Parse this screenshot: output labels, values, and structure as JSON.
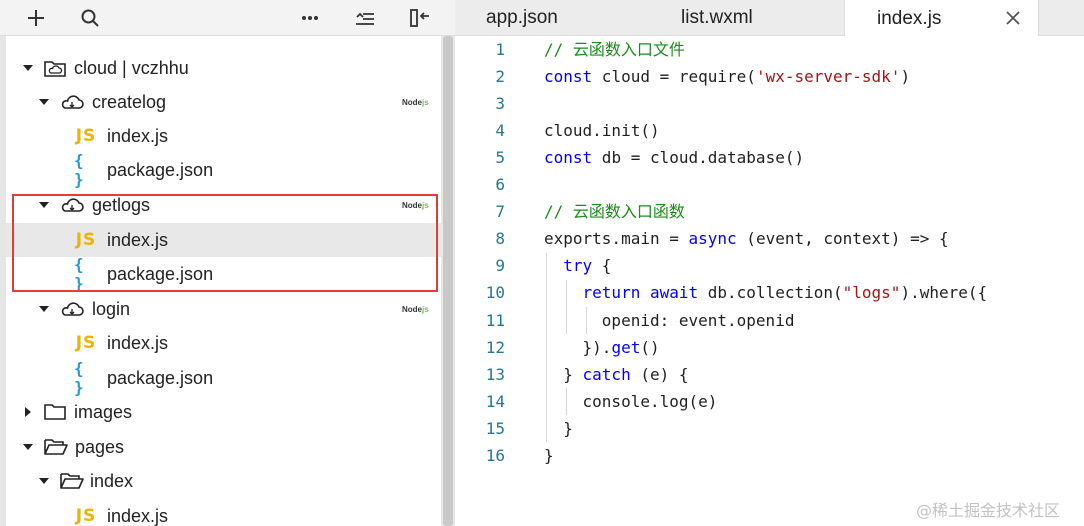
{
  "toolbar": {
    "buttons": [
      "add-icon",
      "search-icon",
      "more-icon",
      "collapse-icon",
      "split-view-icon"
    ]
  },
  "tree": {
    "rows": [
      {
        "label": "cloud | vczhhu",
        "type": "folder-cloud-root",
        "expanded": true
      },
      {
        "label": "createlog",
        "type": "cloud-function",
        "expanded": true,
        "badge": "Node"
      },
      {
        "label": "index.js",
        "type": "js"
      },
      {
        "label": "package.json",
        "type": "json"
      },
      {
        "label": "getlogs",
        "type": "cloud-function",
        "expanded": true,
        "badge": "Node"
      },
      {
        "label": "index.js",
        "type": "js",
        "selected": true
      },
      {
        "label": "package.json",
        "type": "json"
      },
      {
        "label": "login",
        "type": "cloud-function",
        "expanded": true,
        "badge": "Node"
      },
      {
        "label": "index.js",
        "type": "js"
      },
      {
        "label": "package.json",
        "type": "json"
      },
      {
        "label": "images",
        "type": "folder",
        "expanded": false
      },
      {
        "label": "pages",
        "type": "folder",
        "expanded": true
      },
      {
        "label": "index",
        "type": "folder",
        "expanded": true
      },
      {
        "label": "index.js",
        "type": "js"
      }
    ],
    "badge_text": "Node",
    "badge_suffix": "js",
    "js_icon_text": "JS",
    "json_icon_text": "{ }"
  },
  "tabs": [
    {
      "label": "app.json",
      "active": false
    },
    {
      "label": "list.wxml",
      "active": false
    },
    {
      "label": "index.js",
      "active": true
    }
  ],
  "editor": {
    "lines": [
      {
        "n": "1",
        "tokens": [
          [
            "c-comment",
            "// 云函数入口文件"
          ]
        ]
      },
      {
        "n": "2",
        "tokens": [
          [
            "c-kw",
            "const"
          ],
          [
            "",
            " cloud = require("
          ],
          [
            "c-str",
            "'wx-server-sdk'"
          ],
          [
            "",
            ")"
          ]
        ]
      },
      {
        "n": "3",
        "tokens": []
      },
      {
        "n": "4",
        "tokens": [
          [
            "",
            "cloud.init()"
          ]
        ]
      },
      {
        "n": "5",
        "tokens": [
          [
            "c-kw",
            "const"
          ],
          [
            "",
            " db = cloud.database()"
          ]
        ]
      },
      {
        "n": "6",
        "tokens": []
      },
      {
        "n": "7",
        "tokens": [
          [
            "c-comment",
            "// 云函数入口函数"
          ]
        ]
      },
      {
        "n": "8",
        "tokens": [
          [
            "",
            "exports.main = "
          ],
          [
            "c-kw",
            "async"
          ],
          [
            "",
            " (event, context) => {"
          ]
        ]
      },
      {
        "n": "9",
        "tokens": [
          [
            "",
            "  "
          ],
          [
            "c-kw",
            "try"
          ],
          [
            "",
            " {"
          ]
        ]
      },
      {
        "n": "10",
        "tokens": [
          [
            "",
            "    "
          ],
          [
            "c-kw",
            "return"
          ],
          [
            "",
            " "
          ],
          [
            "c-kw",
            "await"
          ],
          [
            "",
            " db.collection("
          ],
          [
            "c-str",
            "\"logs\""
          ],
          [
            "",
            ").where({"
          ]
        ]
      },
      {
        "n": "11",
        "tokens": [
          [
            "",
            "      openid: event.openid"
          ]
        ]
      },
      {
        "n": "12",
        "tokens": [
          [
            "",
            "    })."
          ],
          [
            "c-kw",
            "get"
          ],
          [
            "",
            "()"
          ]
        ]
      },
      {
        "n": "13",
        "tokens": [
          [
            "",
            "  } "
          ],
          [
            "c-kw",
            "catch"
          ],
          [
            "",
            " (e) {"
          ]
        ]
      },
      {
        "n": "14",
        "tokens": [
          [
            "",
            "    console.log(e)"
          ]
        ]
      },
      {
        "n": "15",
        "tokens": [
          [
            "",
            "  }"
          ]
        ]
      },
      {
        "n": "16",
        "tokens": [
          [
            "",
            "}"
          ]
        ]
      }
    ]
  },
  "watermark": "@稀土掘金技术社区"
}
